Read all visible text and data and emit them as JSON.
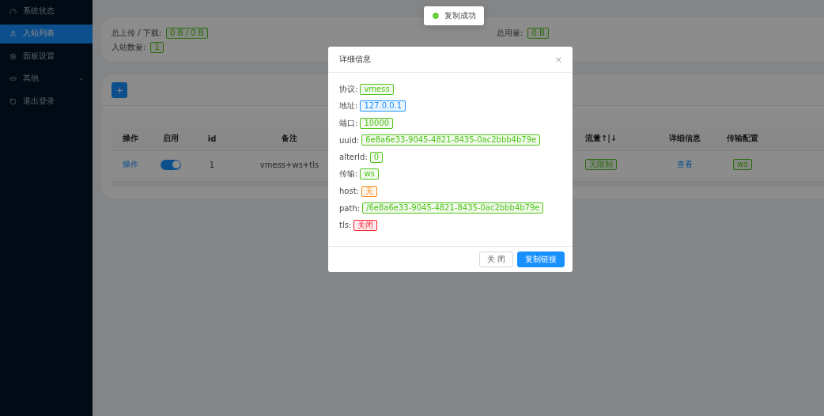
{
  "sidebar": {
    "items": [
      {
        "label": "系统状态",
        "selected": false
      },
      {
        "label": "入站列表",
        "selected": true
      },
      {
        "label": "面板设置",
        "selected": false
      },
      {
        "label": "其他",
        "selected": false,
        "expanded": false
      },
      {
        "label": "退出登录",
        "selected": false
      }
    ]
  },
  "stats": [
    {
      "label": "总上传 / 下载:",
      "value": "0 B / 0 B"
    },
    {
      "label": "总用量:",
      "value": "0 B"
    },
    {
      "label": "入站数量:",
      "value": "1"
    }
  ],
  "table": {
    "columns": [
      "操作",
      "启用",
      "id",
      "备注",
      "流量↑|↓",
      "详细信息",
      "传输配置"
    ],
    "rows": [
      {
        "action": "操作",
        "enabled": true,
        "id": "1",
        "remark": "vmess+ws+tls",
        "traffic": "无限制",
        "details": "查看",
        "transport": "ws"
      }
    ]
  },
  "toast": {
    "text": "复制成功"
  },
  "modal": {
    "title": "详细信息",
    "fields": [
      {
        "label": "协议:",
        "value": "vmess",
        "color": "#52c41a"
      },
      {
        "label": "地址:",
        "value": "127.0.0.1",
        "color": "#1890ff"
      },
      {
        "label": "端口:",
        "value": "10000",
        "color": "#52c41a"
      },
      {
        "label": "uuid:",
        "value": "6e8a6e33-9045-4821-8435-0ac2bbb4b79e",
        "color": "#52c41a"
      },
      {
        "label": "alterId:",
        "value": "0",
        "color": "#52c41a"
      },
      {
        "label": "传输:",
        "value": "ws",
        "color": "#52c41a"
      },
      {
        "label": "host:",
        "value": "无",
        "color": "#fa8c16"
      },
      {
        "label": "path:",
        "value": "/6e8a6e33-9045-4821-8435-0ac2bbb4b79e",
        "color": "#52c41a"
      },
      {
        "label": "tls:",
        "value": "关闭",
        "color": "#f5222d"
      }
    ],
    "buttons": [
      {
        "label": "关 闭",
        "primary": false
      },
      {
        "label": "复制链接",
        "primary": true
      }
    ]
  }
}
